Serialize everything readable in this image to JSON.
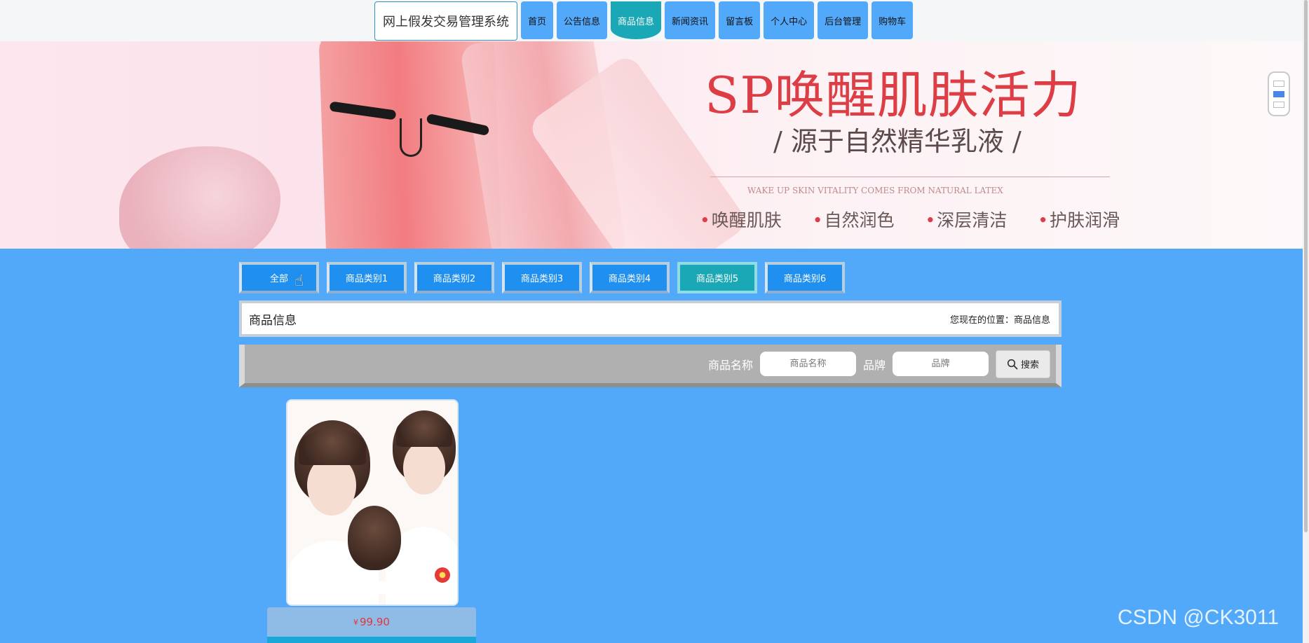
{
  "nav": {
    "site_title": "网上假发交易管理系统",
    "items": [
      {
        "label": "首页"
      },
      {
        "label": "公告信息"
      },
      {
        "label": "商品信息",
        "active": true
      },
      {
        "label": "新闻资讯"
      },
      {
        "label": "留言板"
      },
      {
        "label": "个人中心"
      },
      {
        "label": "后台管理"
      },
      {
        "label": "购物车"
      }
    ]
  },
  "banner": {
    "title": "SP唤醒肌肤活力",
    "subtitle": "/ 源于自然精华乳液 /",
    "english": "WAKE UP SKIN VITALITY COMES FROM NATURAL LATEX",
    "features": [
      "唤醒肌肤",
      "自然润色",
      "深层清洁",
      "护肤润滑"
    ],
    "slider_active_index": 1,
    "slider_count": 3
  },
  "categories": [
    {
      "label": "全部"
    },
    {
      "label": "商品类别1"
    },
    {
      "label": "商品类别2"
    },
    {
      "label": "商品类别3"
    },
    {
      "label": "商品类别4"
    },
    {
      "label": "商品类别5",
      "active": true
    },
    {
      "label": "商品类别6"
    }
  ],
  "breadcrumb": {
    "title": "商品信息",
    "path": "您现在的位置：商品信息"
  },
  "search": {
    "name_label": "商品名称",
    "name_placeholder": "商品名称",
    "brand_label": "品牌",
    "brand_placeholder": "品牌",
    "button_label": "搜索"
  },
  "products": [
    {
      "currency": "¥",
      "price": "99.90"
    }
  ],
  "watermark": "CSDN @CK3011",
  "colors": {
    "page_bg": "#52a9fa",
    "nav_button": "#52a9fa",
    "active": "#1aa8b6",
    "category_button": "#1f8ff0",
    "price": "#e5363c"
  }
}
